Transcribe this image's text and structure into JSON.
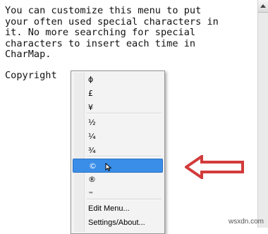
{
  "editor": {
    "lines": [
      "You can customize this menu to put",
      "your often used special characters in",
      "it. No more searching for special",
      "characters to insert each time in",
      "CharMap."
    ],
    "last_word": "Copyright"
  },
  "menu": {
    "group1": [
      "ϕ",
      "£",
      "¥"
    ],
    "group2": [
      "½",
      "¼",
      "¾"
    ],
    "group3": [
      "©",
      "®",
      "™"
    ],
    "selected_item": "©",
    "edit_menu_label": "Edit Menu...",
    "settings_label": "Settings/About..."
  },
  "colors": {
    "highlight": "#3b8ee8",
    "arrow": "#d23b3b"
  },
  "icons": {
    "pointer": "mouse-pointer-icon",
    "annotation": "red-arrow-icon"
  },
  "watermark": "wsxdn.com"
}
